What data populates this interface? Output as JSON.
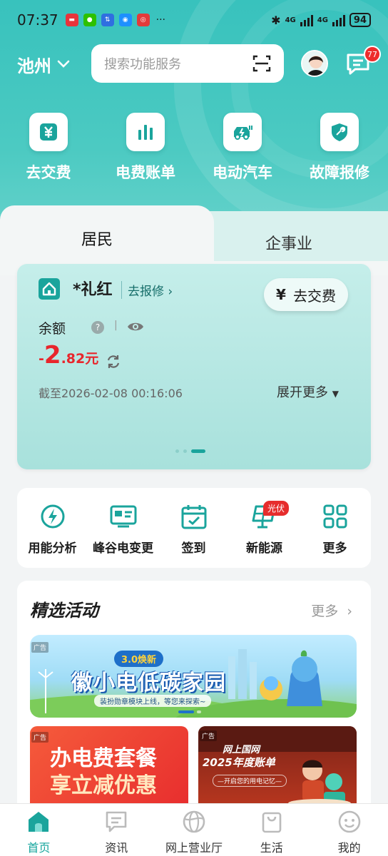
{
  "status_bar": {
    "time": "07:37",
    "more_indicator": "···",
    "battery": "94",
    "network_1": "4G",
    "network_2": "4G"
  },
  "header": {
    "city": "池州",
    "search_placeholder": "搜索功能服务",
    "message_badge": "77"
  },
  "quick_menu": [
    {
      "label": "去交费",
      "icon": "yen-icon"
    },
    {
      "label": "电费账单",
      "icon": "bar-chart-icon"
    },
    {
      "label": "电动汽车",
      "icon": "ev-charger-icon"
    },
    {
      "label": "故障报修",
      "icon": "wrench-shield-icon"
    }
  ],
  "tabs": {
    "resident": "居民",
    "enterprise": "企事业",
    "active": "居民"
  },
  "account": {
    "name": "*礼红",
    "repair_link": "去报修 ›",
    "pay_button": "去交费",
    "pay_icon": "¥",
    "balance_label": "余额",
    "balance_sign": "-",
    "balance_int": "2",
    "balance_dec": ".82元",
    "as_of": "截至2026-02-08 00:16:06",
    "expand": "展开更多"
  },
  "services": [
    {
      "label": "用能分析",
      "icon": "lightning-gauge-icon"
    },
    {
      "label": "峰谷电变更",
      "icon": "meter-card-icon"
    },
    {
      "label": "签到",
      "icon": "calendar-check-icon"
    },
    {
      "label": "新能源",
      "icon": "solar-panel-icon",
      "badge": "光伏"
    },
    {
      "label": "更多",
      "icon": "grid-icon"
    }
  ],
  "activities": {
    "title": "精选活动",
    "more": "更多",
    "ad_tag": "广告",
    "banner_main": {
      "tag": "3.0焕新",
      "title": "徽小电低碳家园",
      "subtitle": "装扮勋章模块上线，等您来探索~"
    },
    "banner_left": {
      "line1": "办电费套餐",
      "line2": "享立减优惠"
    },
    "banner_right": {
      "line1": "网上国网",
      "line2": "2025年度账单",
      "line3": "—开启您的用电记忆—"
    }
  },
  "bottom_nav": [
    {
      "label": "首页",
      "icon": "home-icon",
      "active": true
    },
    {
      "label": "资讯",
      "icon": "news-icon"
    },
    {
      "label": "网上营业厅",
      "icon": "globe-icon"
    },
    {
      "label": "生活",
      "icon": "shopping-bag-icon"
    },
    {
      "label": "我的",
      "icon": "smiley-icon"
    }
  ],
  "colors": {
    "brand_teal": "#16a59d",
    "hero": "#3fc4be",
    "negative": "#e8262c"
  }
}
